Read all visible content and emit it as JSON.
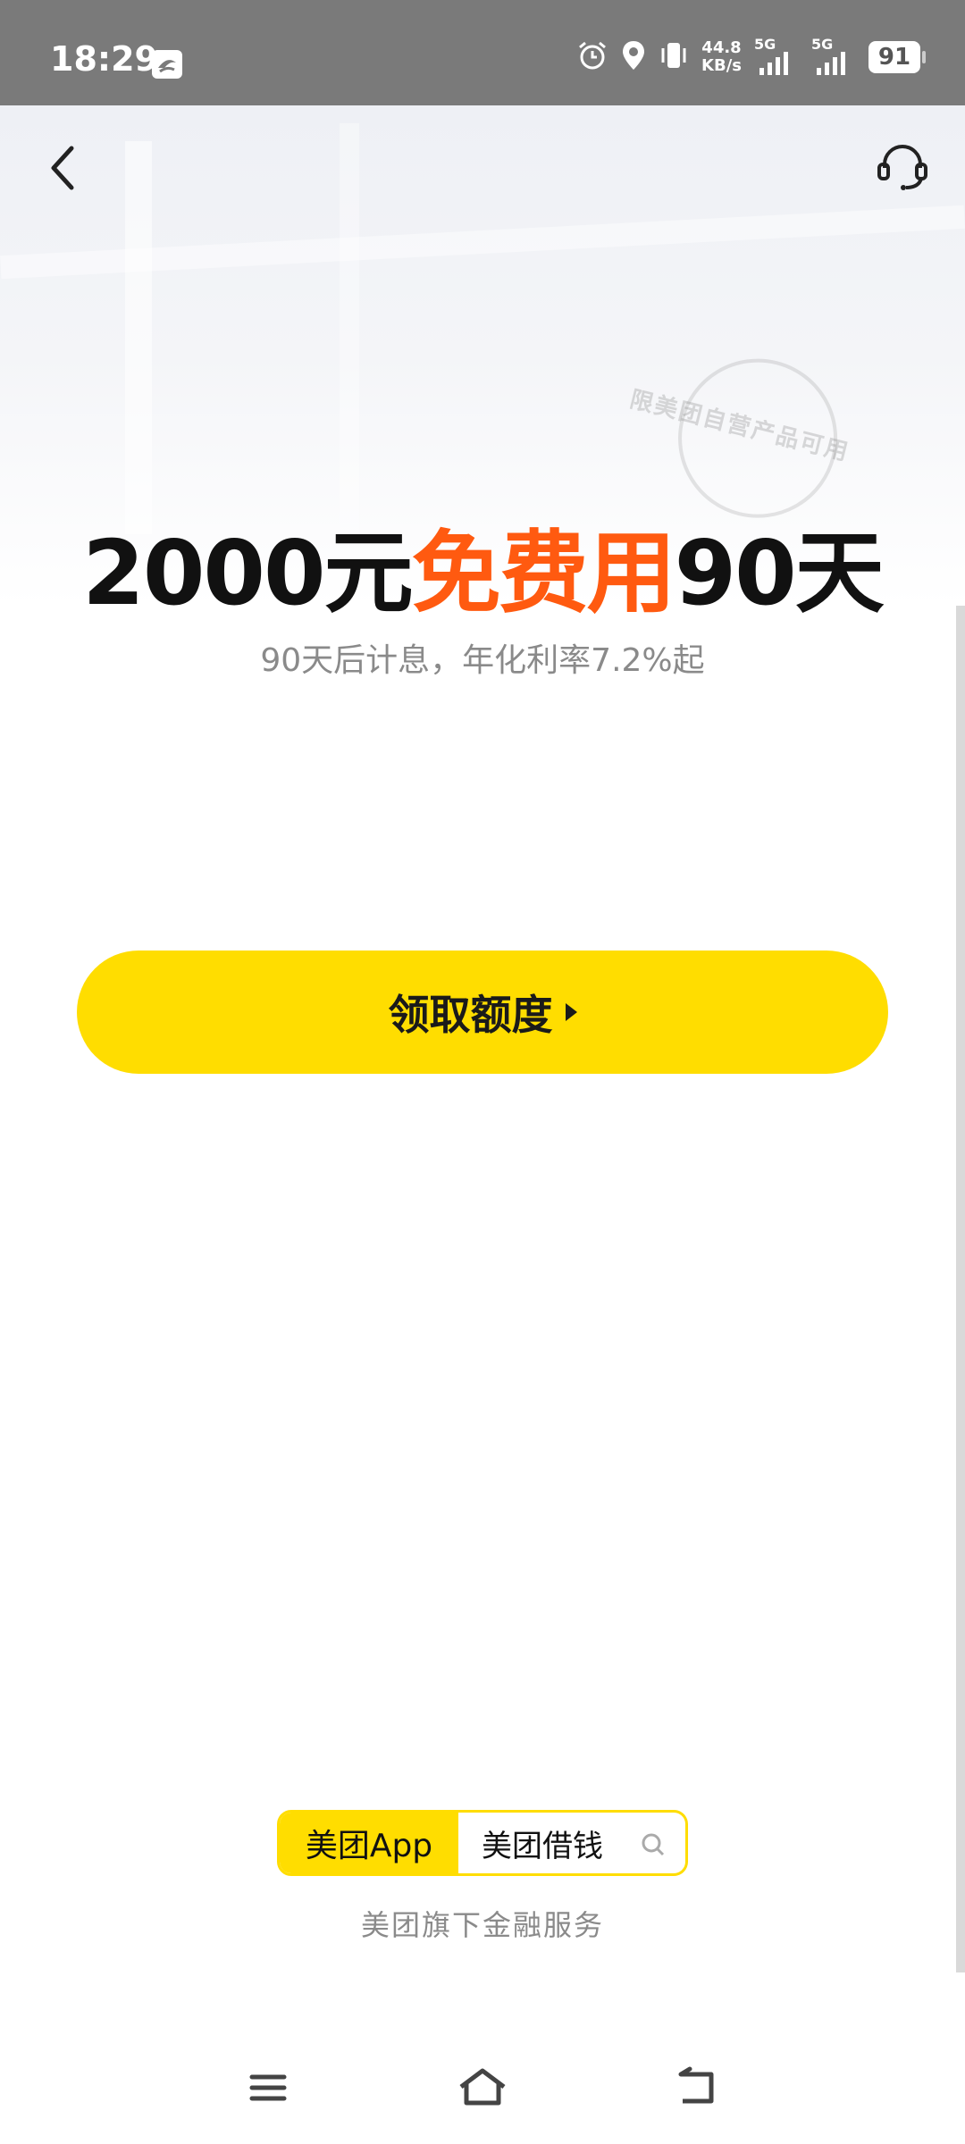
{
  "status_bar": {
    "time": "18:29",
    "net_speed_value": "44.8",
    "net_speed_unit": "KB/s",
    "sim1_label": "5G",
    "sim2_label": "5G",
    "battery": "91"
  },
  "hero": {
    "stamp_text": "限美团自营产品可用",
    "headline_part1": "2000元",
    "headline_highlight": "免费用",
    "headline_part2": "90天",
    "subline": "90天后计息，年化利率7.2%起",
    "highlight_color": "#ff5a10"
  },
  "cta": {
    "label": "领取额度",
    "color": "#ffdd00"
  },
  "brand_search": {
    "app_label": "美团App",
    "query": "美团借钱"
  },
  "footer": {
    "text": "美团旗下金融服务"
  },
  "icons": {
    "back": "back-arrow-icon",
    "customer_service": "headset-icon",
    "search": "search-icon",
    "nav_menu": "menu-icon",
    "nav_home": "home-icon",
    "nav_back": "back-icon"
  }
}
